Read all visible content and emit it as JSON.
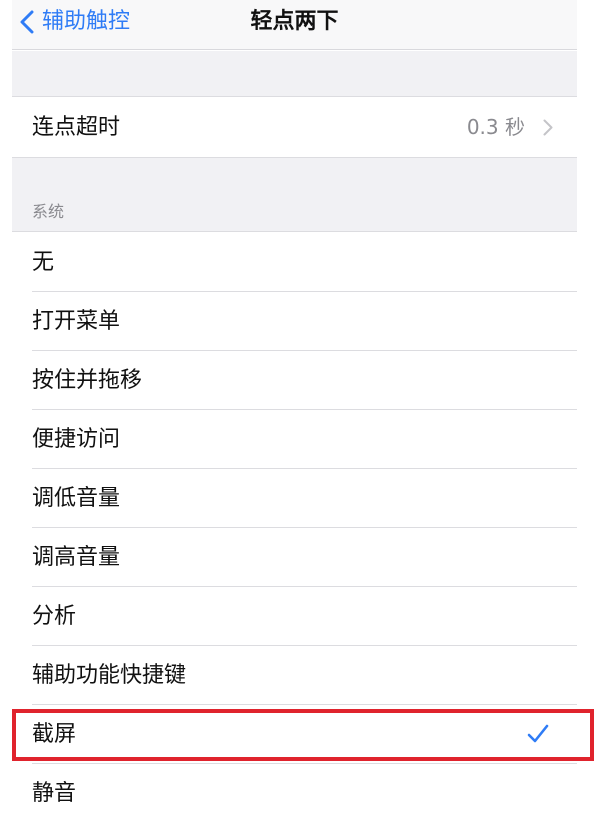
{
  "nav": {
    "back_label": "辅助触控",
    "title": "轻点两下"
  },
  "timeout_row": {
    "label": "连点超时",
    "value": "0.3 秒"
  },
  "section": {
    "header": "系统"
  },
  "actions": [
    {
      "label": "无",
      "selected": false
    },
    {
      "label": "打开菜单",
      "selected": false
    },
    {
      "label": "按住并拖移",
      "selected": false
    },
    {
      "label": "便捷访问",
      "selected": false
    },
    {
      "label": "调低音量",
      "selected": false
    },
    {
      "label": "调高音量",
      "selected": false
    },
    {
      "label": "分析",
      "selected": false
    },
    {
      "label": "辅助功能快捷键",
      "selected": false
    },
    {
      "label": "截屏",
      "selected": true
    },
    {
      "label": "静音",
      "selected": false
    }
  ],
  "colors": {
    "accent": "#2f7cf6",
    "highlight": "#e0232d",
    "group_background": "#f1f1f4",
    "secondary_text": "#8a8a8f"
  },
  "icons": {
    "back": "chevron-left-icon",
    "disclosure": "chevron-right-icon",
    "selected": "checkmark-icon"
  }
}
